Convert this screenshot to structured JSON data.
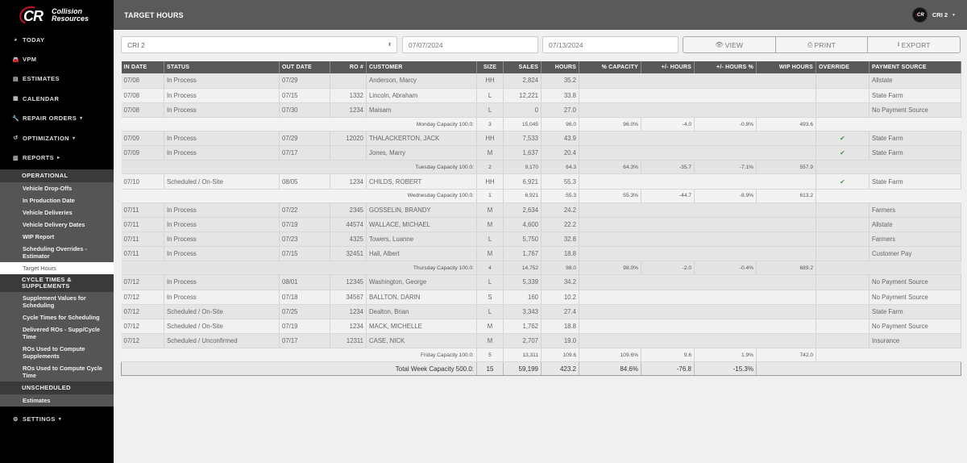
{
  "brand": {
    "name_line1": "Collision",
    "name_line2": "Resources",
    "mark": "CR",
    "accent": "#c8102e"
  },
  "header": {
    "title": "TARGET HOURS",
    "user": "CRI 2",
    "avatar_text": "CR"
  },
  "sidebar": {
    "items": [
      {
        "label": "TODAY",
        "icon": "dashboard-icon"
      },
      {
        "label": "VPM",
        "icon": "car-icon"
      },
      {
        "label": "ESTIMATES",
        "icon": "id-card-icon"
      },
      {
        "label": "CALENDAR",
        "icon": "calendar-icon"
      },
      {
        "label": "REPAIR ORDERS",
        "icon": "wrench-icon",
        "caret": "▾"
      },
      {
        "label": "OPTIMIZATION",
        "icon": "history-icon",
        "caret": "▾"
      },
      {
        "label": "REPORTS",
        "icon": "bar-chart-icon",
        "caret": "▸"
      }
    ],
    "reports": {
      "operational": {
        "label": "OPERATIONAL",
        "items": [
          "Vehicle Drop-Offs",
          "In Production Date",
          "Vehicle Deliveries",
          "Vehicle Delivery Dates",
          "WIP Report",
          "Scheduling Overrides - Estimator",
          "Target Hours"
        ],
        "active": "Target Hours"
      },
      "cycle": {
        "label": "CYCLE TIMES & SUPPLEMENTS",
        "items": [
          "Supplement Values for Scheduling",
          "Cycle Times for Scheduling",
          "Delivered ROs - Supp/Cycle Time",
          "ROs Used to Compute Supplements",
          "ROs Used to Compute Cycle Time"
        ]
      },
      "unscheduled": {
        "label": "UNSCHEDULED",
        "items": [
          "Estimates"
        ]
      }
    },
    "settings": {
      "label": "SETTINGS",
      "caret": "▾"
    }
  },
  "filters": {
    "shop": "CRI 2",
    "start_date": "07/07/2024",
    "end_date": "07/13/2024",
    "buttons": {
      "view": "VIEW",
      "print": "PRINT",
      "export": "EXPORT"
    }
  },
  "table": {
    "columns": [
      "IN DATE",
      "STATUS",
      "OUT DATE",
      "RO #",
      "CUSTOMER",
      "SIZE",
      "SALES",
      "HOURS",
      "% CAPACITY",
      "+/- HOURS",
      "+/- HOURS %",
      "WIP HOURS",
      "OVERRIDE",
      "PAYMENT SOURCE"
    ],
    "groups": [
      {
        "rows": [
          {
            "in": "07/08",
            "status": "In Process",
            "out": "07/29",
            "ro": "",
            "customer": "Anderson, Marcy",
            "size": "HH",
            "sales": "2,824",
            "hours": "35.2",
            "override": false,
            "payment": "Allstate"
          },
          {
            "in": "07/08",
            "status": "In Process",
            "out": "07/15",
            "ro": "1332",
            "customer": "Lincoln, Abraham",
            "size": "L",
            "sales": "12,221",
            "hours": "33.8",
            "override": false,
            "payment": "State Farm"
          },
          {
            "in": "07/08",
            "status": "In Process",
            "out": "07/30",
            "ro": "1234",
            "customer": "Maisam",
            "size": "L",
            "sales": "0",
            "hours": "27.0",
            "override": false,
            "payment": "No Payment Source"
          }
        ],
        "summary": {
          "label": "Monday Capacity 100.0:",
          "count": "3",
          "sales": "15,045",
          "hours": "96.0",
          "capacity": "96.0%",
          "diff": "-4.0",
          "diff_pct": "-0.8%",
          "wip": "493.6"
        }
      },
      {
        "rows": [
          {
            "in": "07/09",
            "status": "In Process",
            "out": "07/29",
            "ro": "12020",
            "customer": "THALACKERTON, JACK",
            "size": "HH",
            "sales": "7,533",
            "hours": "43.9",
            "override": true,
            "payment": "State Farm"
          },
          {
            "in": "07/09",
            "status": "In Process",
            "out": "07/17",
            "ro": "",
            "customer": "Jones, Marry",
            "size": "M",
            "sales": "1,637",
            "hours": "20.4",
            "override": true,
            "payment": "State Farm"
          }
        ],
        "summary": {
          "label": "Tuesday Capacity 100.0:",
          "count": "2",
          "sales": "9,170",
          "hours": "64.3",
          "capacity": "64.3%",
          "diff": "-35.7",
          "diff_pct": "-7.1%",
          "wip": "557.9"
        }
      },
      {
        "rows": [
          {
            "in": "07/10",
            "status": "Scheduled / On-Site",
            "out": "08/05",
            "ro": "1234",
            "customer": "CHILDS, ROBERT",
            "size": "HH",
            "sales": "6,921",
            "hours": "55.3",
            "override": true,
            "payment": "State Farm"
          }
        ],
        "summary": {
          "label": "Wednesday Capacity 100.0:",
          "count": "1",
          "sales": "6,921",
          "hours": "55.3",
          "capacity": "55.3%",
          "diff": "-44.7",
          "diff_pct": "-8.9%",
          "wip": "613.2"
        }
      },
      {
        "rows": [
          {
            "in": "07/11",
            "status": "In Process",
            "out": "07/22",
            "ro": "2345",
            "customer": "GOSSELIN, BRANDY",
            "size": "M",
            "sales": "2,634",
            "hours": "24.2",
            "override": false,
            "payment": "Farmers"
          },
          {
            "in": "07/11",
            "status": "In Process",
            "out": "07/19",
            "ro": "44574",
            "customer": "WALLACE, MICHAEL",
            "size": "M",
            "sales": "4,600",
            "hours": "22.2",
            "override": false,
            "payment": "Allstate"
          },
          {
            "in": "07/11",
            "status": "In Process",
            "out": "07/23",
            "ro": "4325",
            "customer": "Towers, Luanne",
            "size": "L",
            "sales": "5,750",
            "hours": "32.8",
            "override": false,
            "payment": "Farmers"
          },
          {
            "in": "07/11",
            "status": "In Process",
            "out": "07/15",
            "ro": "32451",
            "customer": "Hall, Albert",
            "size": "M",
            "sales": "1,767",
            "hours": "18.8",
            "override": false,
            "payment": "Customer Pay"
          }
        ],
        "summary": {
          "label": "Thursday Capacity 100.0:",
          "count": "4",
          "sales": "14,752",
          "hours": "98.0",
          "capacity": "98.0%",
          "diff": "-2.0",
          "diff_pct": "-0.4%",
          "wip": "689.2"
        }
      },
      {
        "rows": [
          {
            "in": "07/12",
            "status": "In Process",
            "out": "08/01",
            "ro": "12345",
            "customer": "Washington, George",
            "size": "L",
            "sales": "5,339",
            "hours": "34.2",
            "override": false,
            "payment": "No Payment Source"
          },
          {
            "in": "07/12",
            "status": "In Process",
            "out": "07/18",
            "ro": "34567",
            "customer": "BALLTON, DARIN",
            "size": "S",
            "sales": "160",
            "hours": "10.2",
            "override": false,
            "payment": "No Payment Source"
          },
          {
            "in": "07/12",
            "status": "Scheduled / On-Site",
            "out": "07/25",
            "ro": "1234",
            "customer": "Dealton, Brian",
            "size": "L",
            "sales": "3,343",
            "hours": "27.4",
            "override": false,
            "payment": "State Farm"
          },
          {
            "in": "07/12",
            "status": "Scheduled / On-Site",
            "out": "07/19",
            "ro": "1234",
            "customer": "MACK, MICHELLE",
            "size": "M",
            "sales": "1,762",
            "hours": "18.8",
            "override": false,
            "payment": "No Payment Source"
          },
          {
            "in": "07/12",
            "status": "Scheduled / Unconfirmed",
            "out": "07/17",
            "ro": "12311",
            "customer": "CASE, NICK",
            "size": "M",
            "sales": "2,707",
            "hours": "19.0",
            "override": false,
            "payment": "Insurance"
          }
        ],
        "summary": {
          "label": "Friday Capacity 100.0:",
          "count": "5",
          "sales": "13,311",
          "hours": "109.6",
          "capacity": "109.6%",
          "diff": "9.6",
          "diff_pct": "1.9%",
          "wip": "742.0"
        }
      }
    ],
    "total": {
      "label": "Total Week Capacity 500.0:",
      "count": "15",
      "sales": "59,199",
      "hours": "423.2",
      "capacity": "84.6%",
      "diff": "-76.8",
      "diff_pct": "-15.3%"
    },
    "override_color": "#3a9b46"
  }
}
